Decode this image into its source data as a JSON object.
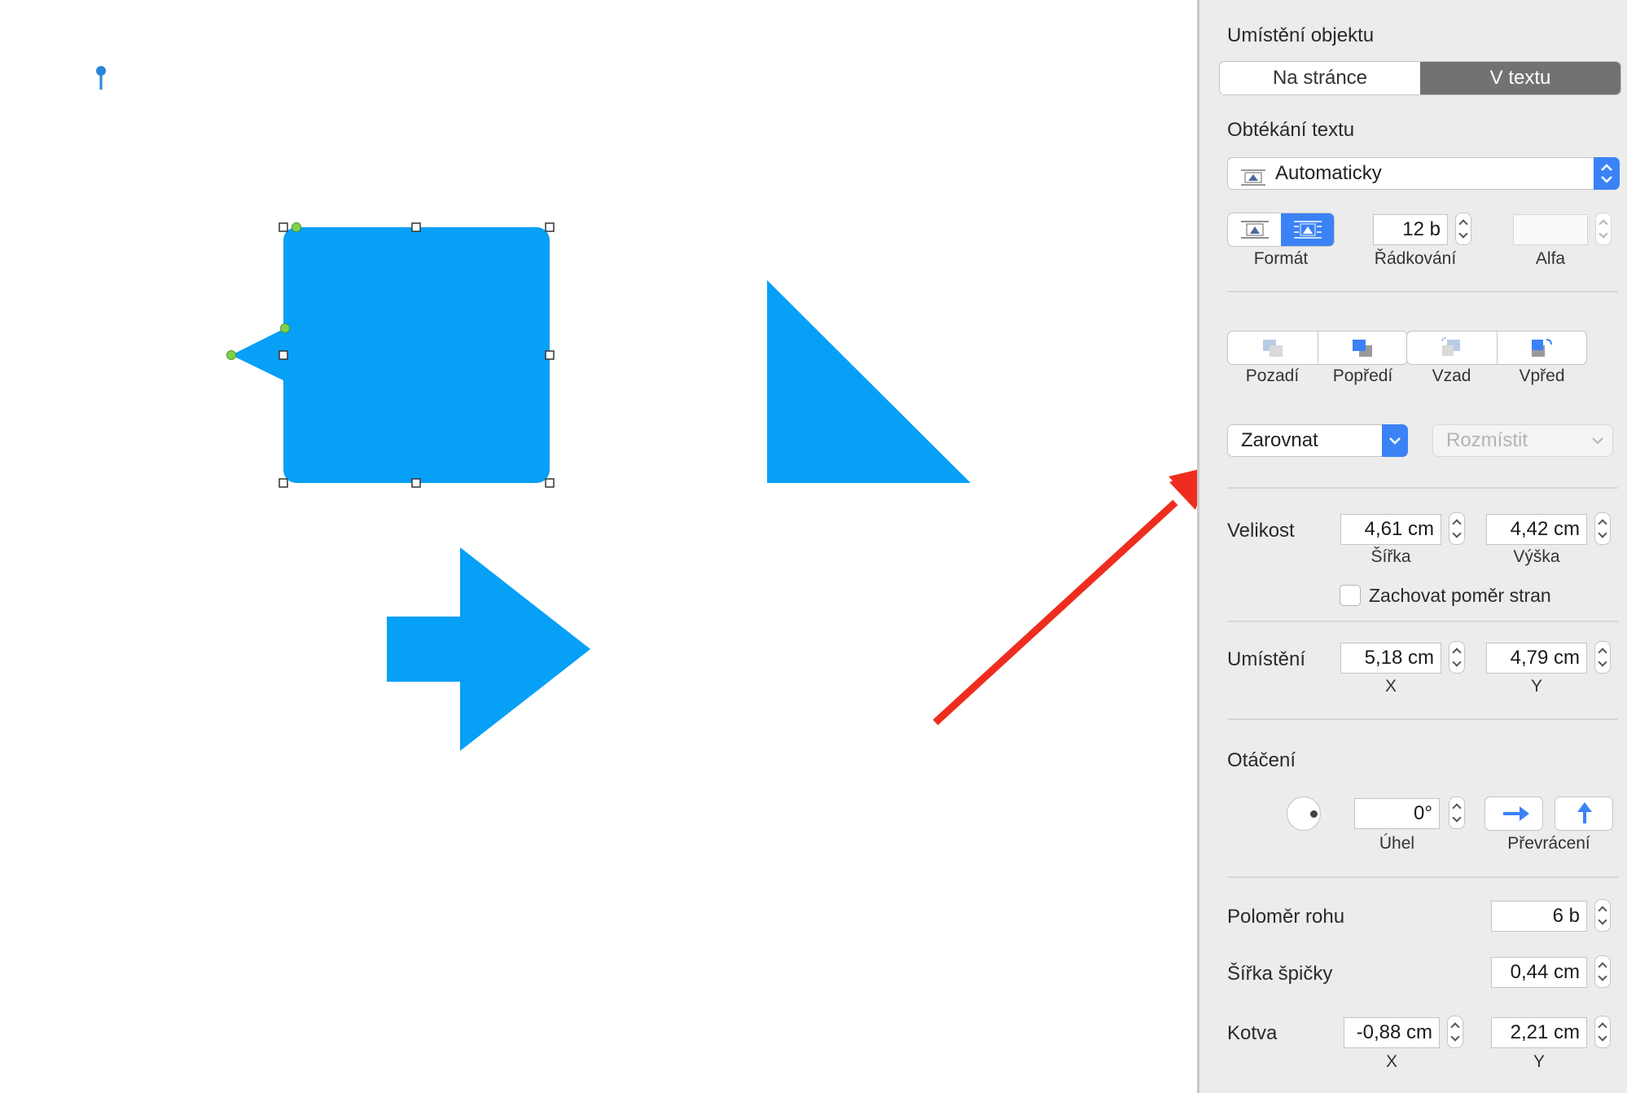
{
  "colors": {
    "shape_fill": "#06a0f7",
    "arrow_annotation": "#ee2d1f",
    "selection_handle": "#7fd24a",
    "accent": "#3b82f6"
  },
  "inspector": {
    "object_placement": {
      "title": "Umístění objektu",
      "options": [
        "Na stránce",
        "V textu"
      ],
      "selected": "V textu"
    },
    "text_wrap": {
      "title": "Obtékání textu",
      "value": "Automaticky",
      "format_label": "Formát",
      "spacing_value": "12 b",
      "spacing_label": "Řádkování",
      "alpha_value": "",
      "alpha_label": "Alfa"
    },
    "arrange": {
      "buttons": [
        "Pozadí",
        "Popředí",
        "Vzad",
        "Vpřed"
      ],
      "align_label": "Zarovnat",
      "distribute_label": "Rozmístit"
    },
    "size": {
      "label": "Velikost",
      "width_value": "4,61 cm",
      "width_label": "Šířka",
      "height_value": "4,42 cm",
      "height_label": "Výška",
      "constrain_label": "Zachovat poměr stran",
      "constrain_checked": false
    },
    "position": {
      "label": "Umístění",
      "x_value": "5,18 cm",
      "x_label": "X",
      "y_value": "4,79 cm",
      "y_label": "Y"
    },
    "rotation": {
      "label": "Otáčení",
      "angle_value": "0°",
      "angle_label": "Úhel",
      "flip_label": "Převrácení"
    },
    "corner_radius": {
      "label": "Poloměr rohu",
      "value": "6 b"
    },
    "tip_width": {
      "label": "Šířka špičky",
      "value": "0,44 cm"
    },
    "anchor": {
      "label": "Kotva",
      "x_value": "-0,88 cm",
      "x_label": "X",
      "y_value": "2,21 cm",
      "y_label": "Y"
    }
  }
}
